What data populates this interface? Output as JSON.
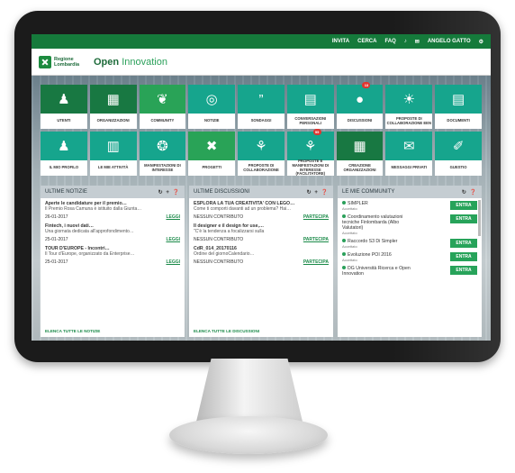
{
  "topnav": [
    "INVITA",
    "CERCA",
    "FAQ",
    "♪",
    "✉",
    "ANGELO GATTO",
    "⚙"
  ],
  "brand": {
    "logo_line1": "Regione",
    "logo_line2": "Lombardia",
    "title_bold": "Open",
    "title_light": "Innovation"
  },
  "tiles_row1": [
    {
      "label": "UTENTI",
      "icon": "♟",
      "style": "dark"
    },
    {
      "label": "ORGANIZZAZIONI",
      "icon": "▦",
      "style": "dark"
    },
    {
      "label": "COMMUNITY",
      "icon": "❦",
      "style": "lime"
    },
    {
      "label": "NOTIZIE",
      "icon": "◎",
      "style": "teal"
    },
    {
      "label": "SONDAGGI",
      "icon": "”",
      "style": "teal"
    },
    {
      "label": "CONVERSAZIONI PERSONALI",
      "icon": "▤",
      "style": "teal"
    },
    {
      "label": "DISCUSSIONI",
      "icon": "●",
      "style": "teal",
      "badge": "13"
    },
    {
      "label": "PROPOSTE DI COLLABORAZIONE EEN",
      "icon": "☀",
      "style": "teal"
    },
    {
      "label": "DOCUMENTI",
      "icon": "▤",
      "style": "teal"
    }
  ],
  "tiles_row2": [
    {
      "label": "IL MIO PROFILO",
      "icon": "♟",
      "style": "teal"
    },
    {
      "label": "LE MIE ATTIVITÀ",
      "icon": "▥",
      "style": "teal"
    },
    {
      "label": "MANIFESTAZIONI DI INTERESSE",
      "icon": "❂",
      "style": "teal"
    },
    {
      "label": "PROGETTI",
      "icon": "✖",
      "style": "lime"
    },
    {
      "label": "PROPOSTE DI COLLABORAZIONE",
      "icon": "⚘",
      "style": "teal"
    },
    {
      "label": "PROPOSTE E MANIFESTAZIONI DI INTERESSE (FACILITATORE)",
      "icon": "⚘",
      "style": "teal",
      "badge": "55"
    },
    {
      "label": "CREAZIONE ORGANIZZAZIONI",
      "icon": "▦",
      "style": "dark"
    },
    {
      "label": "MESSAGGI PRIVATI",
      "icon": "✉",
      "style": "teal"
    },
    {
      "label": "GUESTIO",
      "icon": "✐",
      "style": "teal"
    }
  ],
  "panel_news": {
    "title": "ULTIME NOTIZIE",
    "icons": "↻ + ❓",
    "items": [
      {
        "title": "Aperte le candidature per il premio…",
        "desc": "Il Premio Rosa Camuna è istituito dalla Giunta…",
        "date": "26-01-2017",
        "link": "LEGGI"
      },
      {
        "title": "Fintech, i nuovi dati…",
        "desc": "Una giornata dedicata all'approfondimento…",
        "date": "25-01-2017",
        "link": "LEGGI"
      },
      {
        "title": "TOUR D'EUROPE - Incontri…",
        "desc": "Il Tour d'Europe, organizzato da Enterprise…",
        "date": "25-01-2017",
        "link": "LEGGI"
      }
    ],
    "footer": "ELENCA TUTTE LE NOTIZIE"
  },
  "panel_disc": {
    "title": "ULTIME DISCUSSIONI",
    "icons": "↻ + ❓",
    "items": [
      {
        "title": "ESPLORA LA TUA CREATIVITA' CON LEGO…",
        "desc": "Come ti comporti davanti ad un problema? Hai…",
        "status": "NESSUN CONTRIBUTO",
        "link": "PARTECIPA"
      },
      {
        "title": "Il designer e il design for use,…",
        "desc": "\"C'è la tendenza a focalizzarsi sulla",
        "status": "NESSUN CONTRIBUTO",
        "link": "PARTECIPA"
      },
      {
        "title": "CdR_014_20170116",
        "desc": "Ordine del giornoCalendario…",
        "status": "NESSUN CONTRIBUTO",
        "link": "PARTECIPA"
      }
    ],
    "footer": "ELENCA TUTTE LE DISCUSSIONI"
  },
  "panel_comm": {
    "title": "LE MIE COMMUNITY",
    "icons": "↻ ❓",
    "items": [
      {
        "name": "SIMPLER",
        "status": "Accettato",
        "button": "ENTRA"
      },
      {
        "name": "Coordinamento valutazioni tecniche Finlombarda (Albo Valutatori)",
        "status": "Accettato",
        "button": "ENTRA"
      },
      {
        "name": "Raccordo S3 Di Simpler",
        "status": "Accettato",
        "button": "ENTRA"
      },
      {
        "name": "Evoluzione POI 2016",
        "status": "Accettato",
        "button": "ENTRA"
      },
      {
        "name": "DG Università Ricerca e Open Innovation",
        "status": "",
        "button": "ENTRA"
      }
    ]
  }
}
